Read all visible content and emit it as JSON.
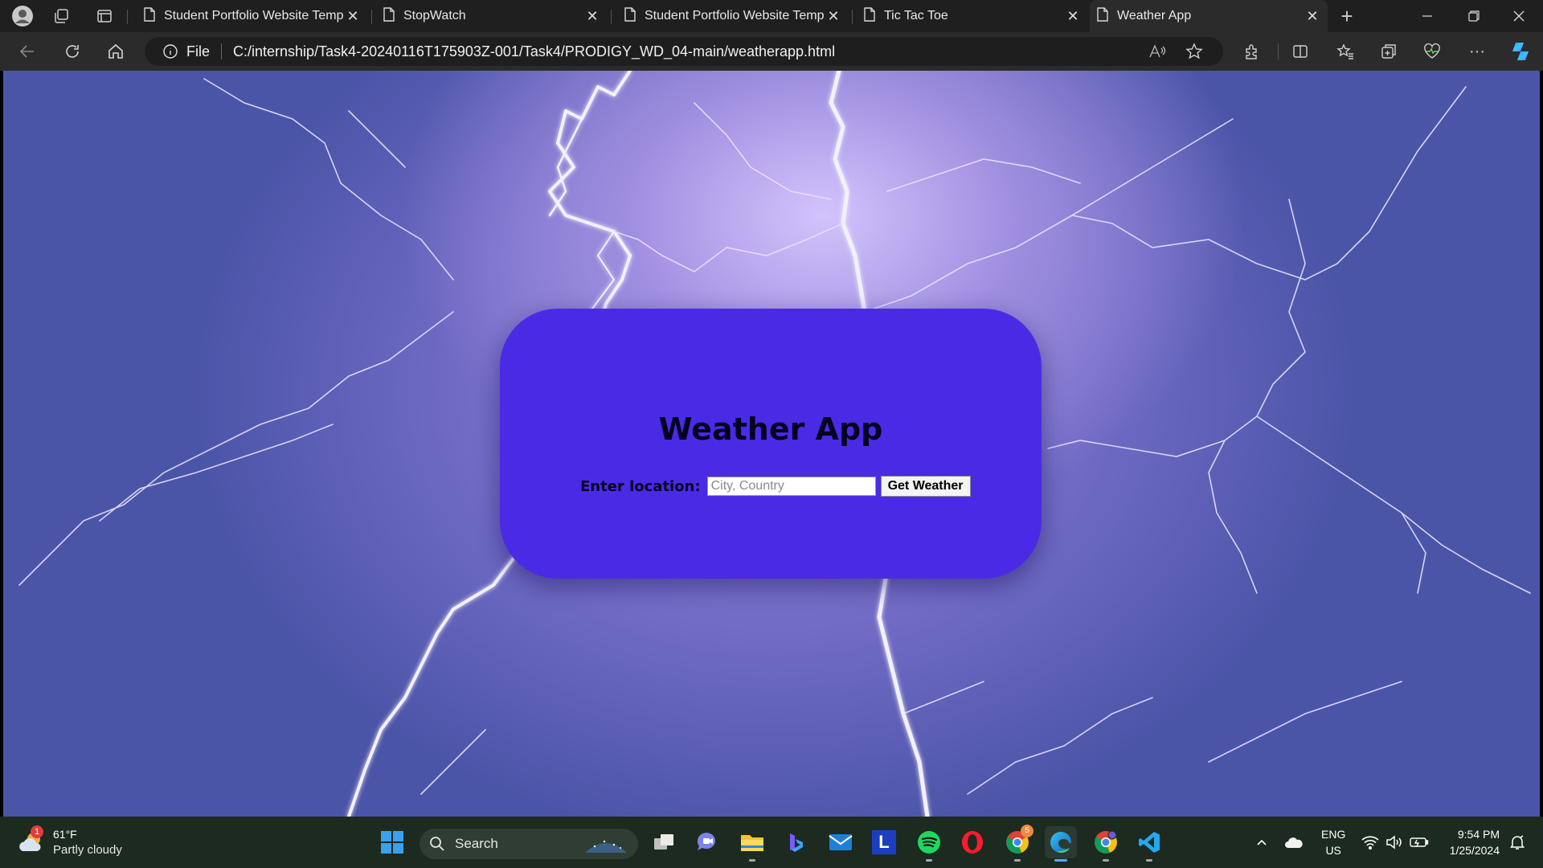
{
  "browser": {
    "tabs": [
      {
        "title": "Student Portfolio Website Templa",
        "active": false
      },
      {
        "title": "StopWatch",
        "active": false
      },
      {
        "title": "Student Portfolio Website Templa",
        "active": false
      },
      {
        "title": "Tic Tac Toe",
        "active": false
      },
      {
        "title": "Weather App",
        "active": true
      }
    ],
    "new_tab_label": "+",
    "address": {
      "scheme_label": "File",
      "url": "C:/internship/Task4-20240116T175903Z-001/Task4/PRODIGY_WD_04-main/weatherapp.html"
    }
  },
  "page": {
    "title": "Weather App",
    "location_label": "Enter location:",
    "location_value": "",
    "location_placeholder": "City, Country",
    "submit_label": "Get Weather"
  },
  "taskbar": {
    "weather_temp": "61°F",
    "weather_desc": "Partly cloudy",
    "weather_badge": "1",
    "search_label": "Search",
    "lang_top": "ENG",
    "lang_bottom": "US",
    "time": "9:54 PM",
    "date": "1/25/2024",
    "chrome_badge": "5",
    "l_app_letter": "L"
  },
  "colors": {
    "card": "#4b2ae6",
    "accent": "#5aa9ff"
  }
}
